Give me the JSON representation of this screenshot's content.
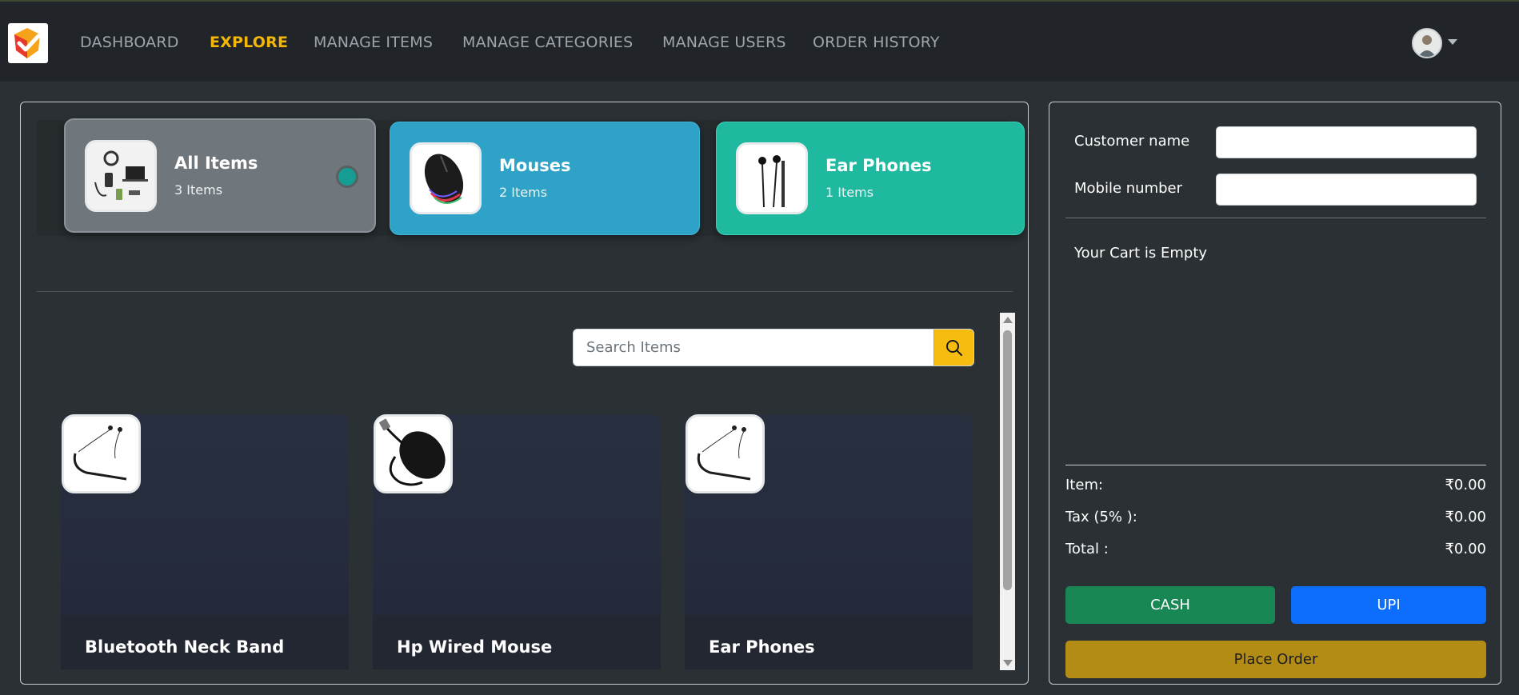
{
  "nav": {
    "logo": "app-logo",
    "links": [
      "DASHBOARD",
      "EXPLORE",
      "MANAGE ITEMS",
      "MANAGE CATEGORIES",
      "MANAGE USERS",
      "ORDER HISTORY"
    ],
    "active": "EXPLORE"
  },
  "categories": [
    {
      "name": "All Items",
      "count": "3 Items",
      "selected": true,
      "color": "#6e767c",
      "icon": "electronics-bundle-icon"
    },
    {
      "name": "Mouses",
      "count": "2 Items",
      "selected": false,
      "color": "#2fa3c7",
      "icon": "gaming-mouse-icon"
    },
    {
      "name": "Ear Phones",
      "count": "1 Items",
      "selected": false,
      "color": "#1fb9a0",
      "icon": "earphones-icon"
    }
  ],
  "search": {
    "placeholder": "Search Items",
    "value": ""
  },
  "items": [
    {
      "name": "Bluetooth Neck Band",
      "icon": "neckband-icon"
    },
    {
      "name": "Hp Wired Mouse",
      "icon": "wired-mouse-icon"
    },
    {
      "name": "Ear Phones",
      "icon": "neckband-icon"
    }
  ],
  "customer": {
    "name_label": "Customer name",
    "name_value": "",
    "mobile_label": "Mobile number",
    "mobile_value": ""
  },
  "cart": {
    "empty_text": "Your Cart is Empty"
  },
  "summary": [
    {
      "label": "Item:",
      "value": "₹0.00"
    },
    {
      "label": "Tax (5% ):",
      "value": "₹0.00"
    },
    {
      "label": "Total :",
      "value": "₹0.00"
    }
  ],
  "actions": {
    "cash": "CASH",
    "upi": "UPI",
    "place_order": "Place Order"
  },
  "colors": {
    "accent": "#f2b707",
    "cash": "#198754",
    "upi": "#0d6efd",
    "place_order": "#b38c16"
  }
}
